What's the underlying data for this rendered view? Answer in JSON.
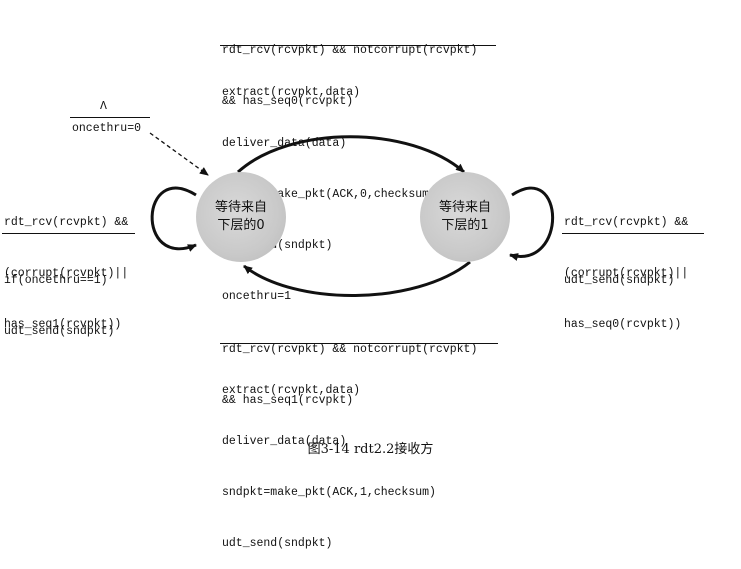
{
  "top_transition": {
    "condition": [
      "rdt_rcv(rcvpkt) && notcorrupt(rcvpkt)",
      "&& has_seq0(rcvpkt)"
    ],
    "actions": [
      "extract(rcvpkt,data)",
      "deliver_data(data)",
      "sndpkt=make_pkt(ACK,0,checksum)",
      "udt_send(sndpkt)",
      "oncethru=1"
    ]
  },
  "bottom_transition": {
    "condition": [
      "rdt_rcv(rcvpkt) && notcorrupt(rcvpkt)",
      "&& has_seq1(rcvpkt)"
    ],
    "actions": [
      "extract(rcvpkt,data)",
      "deliver_data(data)",
      "sndpkt=make_pkt(ACK,1,checksum)",
      "udt_send(sndpkt)"
    ]
  },
  "initial_transition": {
    "condition": "Λ",
    "action": "oncethru=0"
  },
  "left_self_loop": {
    "condition": [
      "rdt_rcv(rcvpkt) &&",
      "(corrupt(rcvpkt)||",
      "has_seq1(rcvpkt))"
    ],
    "actions": [
      "if(oncethru==1)",
      "udt_send(sndpkt)"
    ]
  },
  "right_self_loop": {
    "condition": [
      "rdt_rcv(rcvpkt) &&",
      "(corrupt(rcvpkt)||",
      "has_seq0(rcvpkt))"
    ],
    "actions": [
      "udt_send(sndpkt)"
    ]
  },
  "states": {
    "wait0": [
      "等待来自",
      "下层的0"
    ],
    "wait1": [
      "等待来自",
      "下层的1"
    ]
  },
  "caption": "图3-14   rdt2.2接收方",
  "colors": {
    "state_fill": "#c9c9c9",
    "ink": "#111111"
  }
}
